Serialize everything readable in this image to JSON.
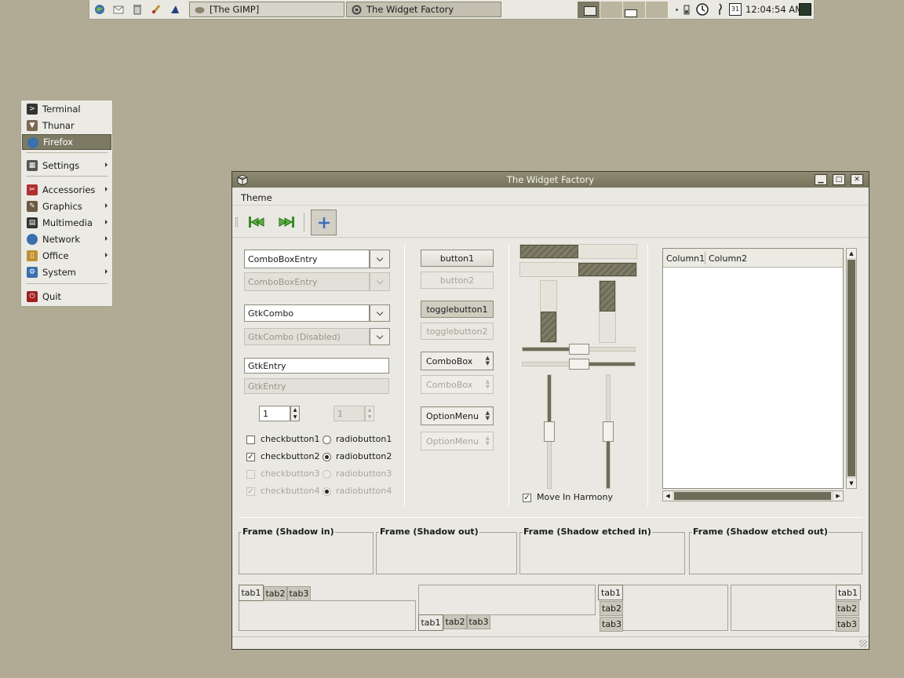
{
  "panel": {
    "tasks": [
      {
        "label": "[The GIMP]",
        "icon": "gimp-icon"
      },
      {
        "label": "The Widget Factory",
        "icon": "widget-factory-icon"
      }
    ],
    "clock": "12:04:54 AM",
    "calendar_day": "31"
  },
  "menu": {
    "items": [
      {
        "label": "Terminal",
        "icon": "terminal-icon",
        "color": "#333333"
      },
      {
        "label": "Thunar",
        "icon": "file-manager-icon",
        "color": "#7a6a52"
      },
      {
        "label": "Firefox",
        "icon": "globe-icon",
        "color": "#3a6fb0"
      },
      {
        "label": "Settings",
        "icon": "settings-icon",
        "color": "#555555"
      },
      {
        "label": "Accessories",
        "icon": "accessories-icon",
        "color": "#b03030"
      },
      {
        "label": "Graphics",
        "icon": "graphics-icon",
        "color": "#6a5a40"
      },
      {
        "label": "Multimedia",
        "icon": "multimedia-icon",
        "color": "#333333"
      },
      {
        "label": "Network",
        "icon": "network-icon",
        "color": "#3a6fb0"
      },
      {
        "label": "Office",
        "icon": "office-icon",
        "color": "#c09030"
      },
      {
        "label": "System",
        "icon": "system-icon",
        "color": "#3a6fb0"
      },
      {
        "label": "Quit",
        "icon": "quit-icon",
        "color": "#a02020"
      }
    ],
    "selected": "Firefox",
    "accent": "#7c7a63"
  },
  "window": {
    "title": "The Widget Factory",
    "menubar": {
      "theme": "Theme"
    },
    "combos": {
      "cbe1": "ComboBoxEntry",
      "cbe2": "ComboBoxEntry",
      "gc1": "GtkCombo",
      "gc2": "GtkCombo (Disabled)",
      "entry1": "GtkEntry",
      "entry2": "GtkEntry",
      "spin1": "1",
      "spin2": "1"
    },
    "checks": {
      "c1": "checkbutton1",
      "c2": "checkbutton2",
      "c3": "checkbutton3",
      "c4": "checkbutton4",
      "r1": "radiobutton1",
      "r2": "radiobutton2",
      "r3": "radiobutton3",
      "r4": "radiobutton4",
      "checkmark": "✓"
    },
    "buttons": {
      "b1": "button1",
      "b2": "button2",
      "t1": "togglebutton1",
      "t2": "togglebutton2",
      "combo1": "ComboBox",
      "combo2": "ComboBox",
      "opt1": "OptionMenu",
      "opt2": "OptionMenu"
    },
    "ranges": {
      "progress_h1": 0.5,
      "progress_h2": 0.5,
      "progress_v1": 0.5,
      "progress_v2": 0.5,
      "hscale1": 0.5,
      "hscale2": 0.5,
      "vscale1": 0.5,
      "vscale2": 0.5,
      "harmony_label": "Move In Harmony"
    },
    "tree": {
      "col1": "Column1",
      "col2": "Column2"
    },
    "frames": {
      "f1": "Frame (Shadow in)",
      "f2": "Frame (Shadow out)",
      "f3": "Frame (Shadow etched in)",
      "f4": "Frame (Shadow etched out)"
    },
    "tabs": [
      "tab1",
      "tab2",
      "tab3"
    ]
  }
}
